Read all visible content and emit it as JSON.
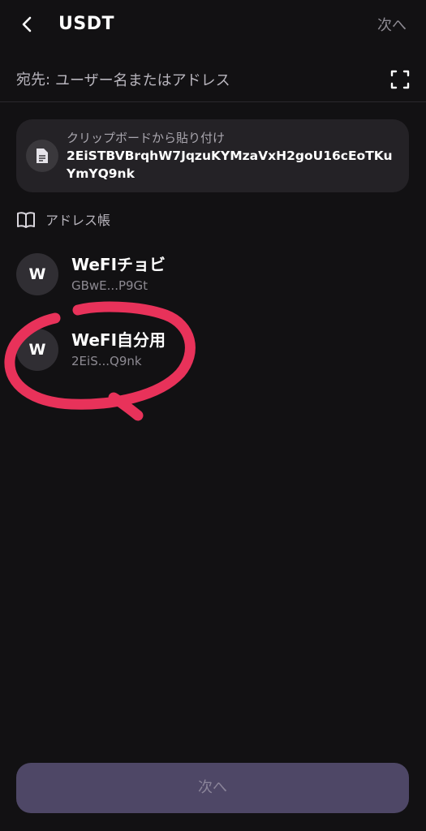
{
  "header": {
    "title": "USDT",
    "next_label": "次へ"
  },
  "destination": {
    "label": "宛先:",
    "placeholder": "ユーザー名またはアドレス"
  },
  "clipboard": {
    "label": "クリップボードから貼り付け",
    "address": "2EiSTBVBrqhW7JqzuKYMzaVxH2goU16cEoTKuYmYQ9nk"
  },
  "address_book": {
    "label": "アドレス帳",
    "contacts": [
      {
        "initial": "W",
        "name": "WeFIチョビ",
        "address": "GBwE...P9Gt"
      },
      {
        "initial": "W",
        "name": "WeFI自分用",
        "address": "2EiS...Q9nk"
      }
    ]
  },
  "footer": {
    "next_label": "次へ"
  },
  "colors": {
    "background": "#121113",
    "card": "#242226",
    "primary_button_disabled": "#4e4766",
    "annotation": "#e8325a"
  },
  "icons": [
    "back-arrow-icon",
    "scan-icon",
    "clipboard-document-icon",
    "book-icon"
  ]
}
